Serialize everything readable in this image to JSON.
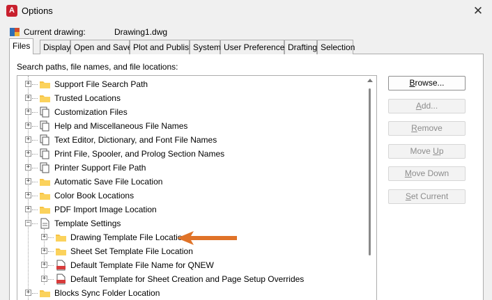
{
  "window": {
    "title": "Options",
    "app_icon_letter": "A",
    "close_glyph": "✕"
  },
  "current_drawing": {
    "label": "Current drawing:",
    "value": "Drawing1.dwg"
  },
  "tabs": [
    {
      "label": "Files",
      "active": true
    },
    {
      "label": "Display"
    },
    {
      "label": "Open and Save"
    },
    {
      "label": "Plot and Publish"
    },
    {
      "label": "System"
    },
    {
      "label": "User Preferences"
    },
    {
      "label": "Drafting"
    },
    {
      "label": "Selection"
    }
  ],
  "files_panel": {
    "label": "Search paths, file names, and file locations:",
    "tree": [
      {
        "label": "Support File Search Path",
        "icon": "folder-icon"
      },
      {
        "label": "Trusted Locations",
        "icon": "folder-icon"
      },
      {
        "label": "Customization Files",
        "icon": "files-icon"
      },
      {
        "label": "Help and Miscellaneous File Names",
        "icon": "files-icon"
      },
      {
        "label": "Text Editor, Dictionary, and Font File Names",
        "icon": "files-icon"
      },
      {
        "label": "Print File, Spooler, and Prolog Section Names",
        "icon": "files-icon"
      },
      {
        "label": "Printer Support File Path",
        "icon": "files-icon"
      },
      {
        "label": "Automatic Save File Location",
        "icon": "folder-icon"
      },
      {
        "label": "Color Book Locations",
        "icon": "folder-icon"
      },
      {
        "label": "PDF Import Image Location",
        "icon": "folder-icon"
      },
      {
        "label": "Template Settings",
        "icon": "document-icon",
        "expanded": true
      },
      {
        "label": "Drawing Template File Location",
        "icon": "folder-icon",
        "child": true
      },
      {
        "label": "Sheet Set Template File Location",
        "icon": "folder-icon",
        "child": true
      },
      {
        "label": "Default Template File Name for QNEW",
        "icon": "dwt-file-icon",
        "child": true
      },
      {
        "label": "Default Template for Sheet Creation and Page Setup Overrides",
        "icon": "dwt-file-icon",
        "child": true
      },
      {
        "label": "Blocks Sync Folder Location",
        "icon": "folder-icon"
      }
    ]
  },
  "buttons": {
    "browse": {
      "pre": "",
      "u": "B",
      "post": "rowse..."
    },
    "add": {
      "pre": "",
      "u": "A",
      "post": "dd..."
    },
    "remove": {
      "pre": "",
      "u": "R",
      "post": "emove"
    },
    "move_up": {
      "pre": "Move ",
      "u": "U",
      "post": "p"
    },
    "move_down": {
      "pre": "",
      "u": "M",
      "post": "ove Down"
    },
    "set_current": {
      "pre": "",
      "u": "S",
      "post": "et Current"
    }
  },
  "colors": {
    "folder": "#f6c244",
    "arrow": "#e07328",
    "dwt_red": "#d83b3b"
  }
}
